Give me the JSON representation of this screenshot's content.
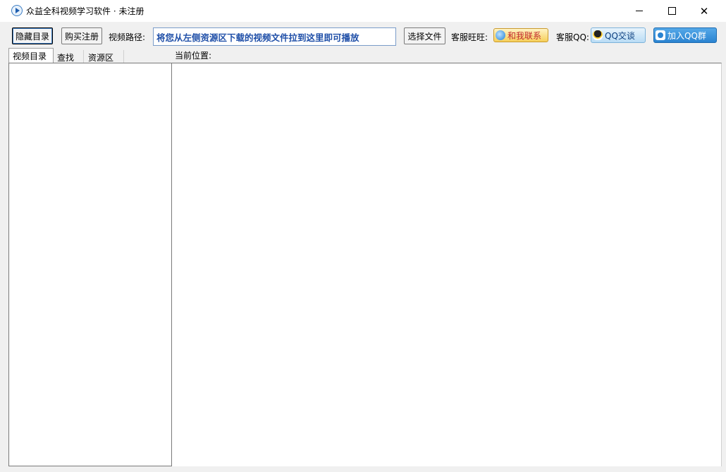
{
  "window": {
    "title": "众益全科视频学习软件 · 未注册",
    "minimize_label": "",
    "maximize_label": "",
    "close_label": "✕"
  },
  "toolbar": {
    "hide_toc_label": "隐藏目录",
    "buy_register_label": "购买注册",
    "video_path_label": "视频路径:",
    "video_path_value": "将您从左侧资源区下载的视频文件拉到这里即可播放",
    "choose_file_label": "选择文件",
    "wangwang_label": "客服旺旺:",
    "wangwang_button_label": "和我联系",
    "qq_label": "客服QQ:",
    "qq_chat_label": "QQ交谈",
    "qq_group_label": "加入QQ群"
  },
  "left_panel": {
    "tabs": [
      {
        "label": "视频目录",
        "active": true
      },
      {
        "label": "查找",
        "active": false
      },
      {
        "label": "资源区",
        "active": false
      }
    ]
  },
  "main": {
    "location_label": "当前位置:"
  },
  "colors": {
    "path_text": "#1f4fa8",
    "window_bg": "#f0f0f0",
    "content_bg": "#ffffff"
  }
}
